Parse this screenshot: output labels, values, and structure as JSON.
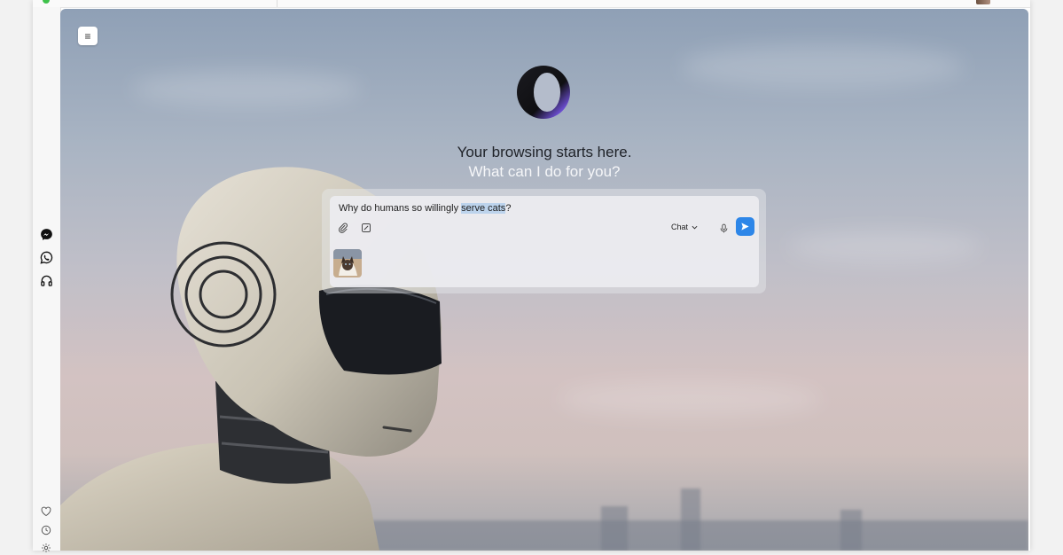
{
  "sidebar": {
    "apps": [
      {
        "name": "messenger-icon"
      },
      {
        "name": "whatsapp-icon"
      },
      {
        "name": "headphones-icon"
      }
    ],
    "bottom": [
      {
        "name": "heart-icon"
      },
      {
        "name": "clock-icon"
      },
      {
        "name": "gear-icon"
      }
    ]
  },
  "main": {
    "menu_icon": "≡",
    "headline": "Your browsing starts here.",
    "subline": "What can I do for you?"
  },
  "composer": {
    "prompt_before": "Why do humans so willingly ",
    "prompt_selected": "serve cats",
    "prompt_after": "?",
    "mode_label": "Chat",
    "attachment": "cat-thumbnail"
  },
  "colors": {
    "send_button": "#2d86e8",
    "selection": "#bcd3ec",
    "status_dot": "#3fc24b"
  }
}
